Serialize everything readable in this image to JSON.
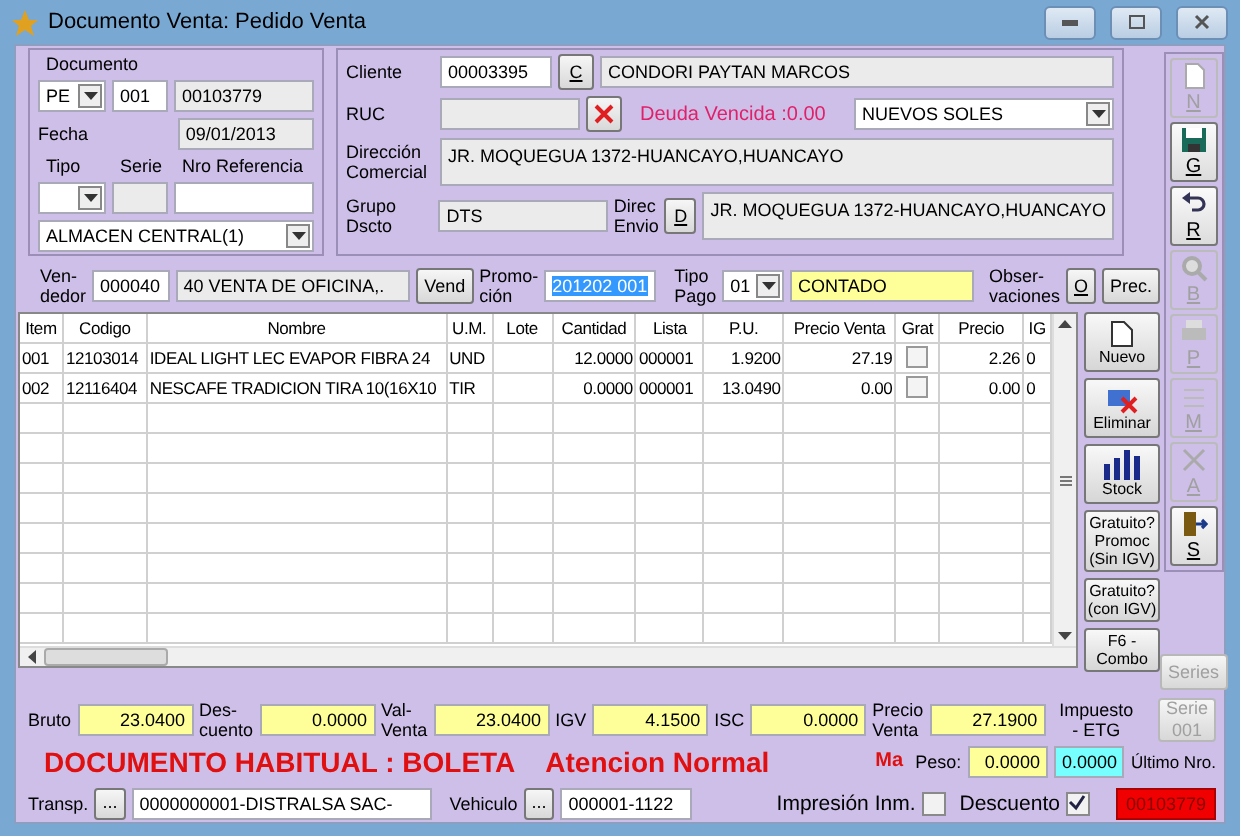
{
  "window": {
    "title": "Documento Venta: Pedido Venta"
  },
  "documento": {
    "legend": "Documento",
    "tipo_doc": "PE",
    "serie": "001",
    "numero": "00103779",
    "fecha_label": "Fecha",
    "fecha": "09/01/2013",
    "tipo_label": "Tipo",
    "serie_label": "Serie",
    "referencia_label": "Nro Referencia",
    "almacen": "ALMACEN CENTRAL(1)"
  },
  "cliente": {
    "label": "Cliente",
    "codigo": "00003395",
    "buscar_button": "C",
    "nombre": "CONDORI PAYTAN MARCOS",
    "ruc_label": "RUC",
    "deuda": "Deuda Vencida :0.00",
    "moneda": "NUEVOS SOLES",
    "direccion_label": "Dirección\nComercial",
    "direccion": "JR. MOQUEGUA 1372-HUANCAYO,HUANCAYO",
    "grupo_label": "Grupo\nDscto",
    "grupo": "DTS",
    "envio_label": "Direc\nEnvio",
    "envio_button": "D",
    "envio": "JR. MOQUEGUA 1372-HUANCAYO,HUANCAYO"
  },
  "venta": {
    "vendedor_label": "Ven-\ndedor",
    "vendedor_codigo": "000040",
    "vendedor_nombre": "40 VENTA DE OFICINA,.",
    "vend_button": "Vend",
    "promocion_label": "Promo-\nción",
    "promocion": "201202 001",
    "tipo_pago_label": "Tipo\nPago",
    "tipo_pago": "01",
    "condicion": "CONTADO",
    "observaciones_label": "Obser-\nvaciones",
    "observaciones_button": "O",
    "precios_button": "Prec."
  },
  "toolbar": [
    {
      "label": "N",
      "kind": "new",
      "disabled": true
    },
    {
      "label": "G",
      "kind": "save",
      "disabled": false
    },
    {
      "label": "R",
      "kind": "undo",
      "disabled": false
    },
    {
      "label": "B",
      "kind": "search",
      "disabled": true
    },
    {
      "label": "P",
      "kind": "print",
      "disabled": true
    },
    {
      "label": "M",
      "kind": "edit",
      "disabled": true
    },
    {
      "label": "A",
      "kind": "cancel",
      "disabled": true
    },
    {
      "label": "S",
      "kind": "exit",
      "disabled": false
    }
  ],
  "table": {
    "columns": [
      "Item",
      "Codigo",
      "Nombre",
      "U.M.",
      "Lote",
      "Cantidad",
      "Lista",
      "P.U.",
      "Precio Venta",
      "Grat",
      "Precio",
      "IG"
    ],
    "rows": [
      {
        "cells": [
          "001",
          "12103014",
          "IDEAL LIGHT LEC EVAPOR FIBRA 24",
          "UND",
          "",
          "12.0000",
          "000001",
          "1.9200",
          "27.19",
          "",
          "2.26",
          "0"
        ],
        "checked": false
      },
      {
        "cells": [
          "002",
          "12116404",
          "NESCAFE TRADICION TIRA 10(16X10",
          "TIR",
          "",
          "0.0000",
          "000001",
          "13.0490",
          "0.00",
          "",
          "0.00",
          "0"
        ],
        "checked": false
      }
    ]
  },
  "actions": [
    {
      "label": "Nuevo",
      "kind": "new"
    },
    {
      "label": "Eliminar",
      "kind": "delete"
    },
    {
      "label": "Stock",
      "kind": "stock"
    },
    {
      "label": "Gratuito?\nPromoc\n(Sin IGV)",
      "kind": "text"
    },
    {
      "label": "Gratuito?\n(con IGV)",
      "kind": "text"
    },
    {
      "label": "F6 -\nCombo",
      "kind": "text"
    }
  ],
  "series_button": {
    "label": "Series",
    "disabled": true
  },
  "totals": [
    {
      "label": "Bruto",
      "value": "23.0400"
    },
    {
      "label": "Des-\ncuento",
      "value": "0.0000"
    },
    {
      "label": "Val-\nVenta",
      "value": "23.0400"
    },
    {
      "label": "IGV",
      "value": "4.1500"
    },
    {
      "label": "ISC",
      "value": "0.0000"
    },
    {
      "label": "Precio\nVenta",
      "value": "27.1900"
    }
  ],
  "impuesto_label": "Impuesto\n- ETG",
  "serie_button": {
    "label": "Serie\n001",
    "disabled": true
  },
  "status": {
    "documento": "DOCUMENTO HABITUAL : BOLETA",
    "atencion": "Atencion Normal",
    "ma": "Ma",
    "peso_label": "Peso:",
    "peso": "0.0000",
    "impuesto": "0.0000",
    "ultimo_label": "Último Nro."
  },
  "footer": {
    "transp_label": "Transp.",
    "transp_button": "...",
    "transportista": "0000000001-DISTRALSA SAC-",
    "vehiculo_label": "Vehiculo",
    "vehiculo_button": "...",
    "vehiculo": "000001-1122",
    "impresion_label": "Impresión Inm.",
    "impresion_checked": false,
    "descuento_label": "Descuento",
    "descuento_checked": true,
    "ultimo_nro": "00103779"
  }
}
